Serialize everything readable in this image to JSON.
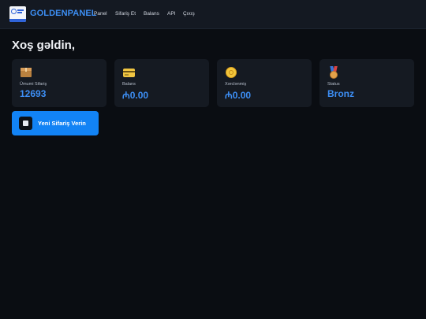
{
  "navbar": {
    "brand": "GOLDENPANEL",
    "links": [
      {
        "label": "Panel"
      },
      {
        "label": "Sifariş Et"
      },
      {
        "label": "Balans"
      },
      {
        "label": "API"
      },
      {
        "label": "Çıxış"
      }
    ]
  },
  "main": {
    "welcome": "Xoş gəldin,",
    "cards": [
      {
        "icon": "package-icon",
        "label": "Ümumi Sifariş",
        "value": "12693"
      },
      {
        "icon": "credit-card-icon",
        "label": "Balans",
        "value": "₼0.00"
      },
      {
        "icon": "coin-icon",
        "label": "Xərclənmiş",
        "value": "₼0.00"
      },
      {
        "icon": "medal-icon",
        "label": "Status",
        "value": "Bronz"
      }
    ],
    "order_button": {
      "label": "Yeni Sifariş Verin",
      "icon": "order-icon"
    }
  },
  "colors": {
    "background": "#0a0d12",
    "navbar": "#141922",
    "card": "#151a22",
    "accent": "#3d8ff5",
    "button": "#1283f5"
  }
}
